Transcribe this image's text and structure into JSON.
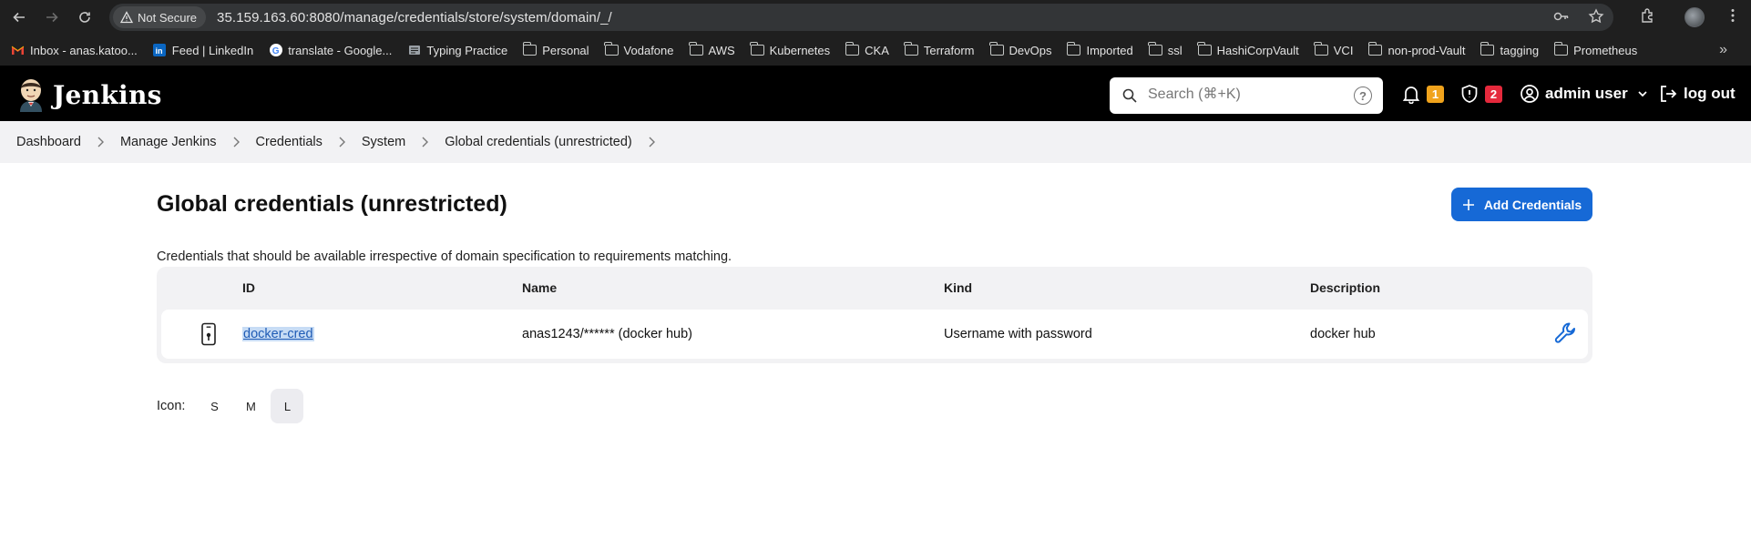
{
  "browser": {
    "security_label": "Not Secure",
    "url": "35.159.163.60:8080/manage/credentials/store/system/domain/_/",
    "bookmarks": [
      {
        "label": "Inbox - anas.katoo...",
        "icon": "gmail-icon"
      },
      {
        "label": "Feed | LinkedIn",
        "icon": "linkedin-icon"
      },
      {
        "label": "translate - Google...",
        "icon": "google-icon"
      },
      {
        "label": "Typing Practice",
        "icon": "typing-icon"
      },
      {
        "label": "Personal",
        "icon": "folder-icon"
      },
      {
        "label": "Vodafone",
        "icon": "folder-icon"
      },
      {
        "label": "AWS",
        "icon": "folder-icon"
      },
      {
        "label": "Kubernetes",
        "icon": "folder-icon"
      },
      {
        "label": "CKA",
        "icon": "folder-icon"
      },
      {
        "label": "Terraform",
        "icon": "folder-icon"
      },
      {
        "label": "DevOps",
        "icon": "folder-icon"
      },
      {
        "label": "Imported",
        "icon": "folder-icon"
      },
      {
        "label": "ssl",
        "icon": "folder-icon"
      },
      {
        "label": "HashiCorpVault",
        "icon": "folder-icon"
      },
      {
        "label": "VCI",
        "icon": "folder-icon"
      },
      {
        "label": "non-prod-Vault",
        "icon": "folder-icon"
      },
      {
        "label": "tagging",
        "icon": "folder-icon"
      },
      {
        "label": "Prometheus",
        "icon": "folder-icon"
      }
    ],
    "more_label": "»"
  },
  "header": {
    "logo_text": "Jenkins",
    "search_placeholder": "Search (⌘+K)",
    "search_help": "?",
    "notifications_count": "1",
    "security_count": "2",
    "user_name": "admin user",
    "logout_label": "log out",
    "colors": {
      "notification_badge": "#f0a31c",
      "security_badge": "#e5293c",
      "accent": "#1669d6"
    }
  },
  "breadcrumb": [
    "Dashboard",
    "Manage Jenkins",
    "Credentials",
    "System",
    "Global credentials (unrestricted)"
  ],
  "main": {
    "title": "Global credentials (unrestricted)",
    "add_button_label": "Add Credentials",
    "description": "Credentials that should be available irrespective of domain specification to requirements matching.",
    "table": {
      "headers": [
        "ID",
        "Name",
        "Kind",
        "Description"
      ],
      "rows": [
        {
          "id": "docker-cred",
          "name": "anas1243/****** (docker hub)",
          "kind": "Username with password",
          "description": "docker hub"
        }
      ]
    },
    "icon_size": {
      "label": "Icon:",
      "options": [
        "S",
        "M",
        "L"
      ],
      "selected": "L"
    }
  }
}
